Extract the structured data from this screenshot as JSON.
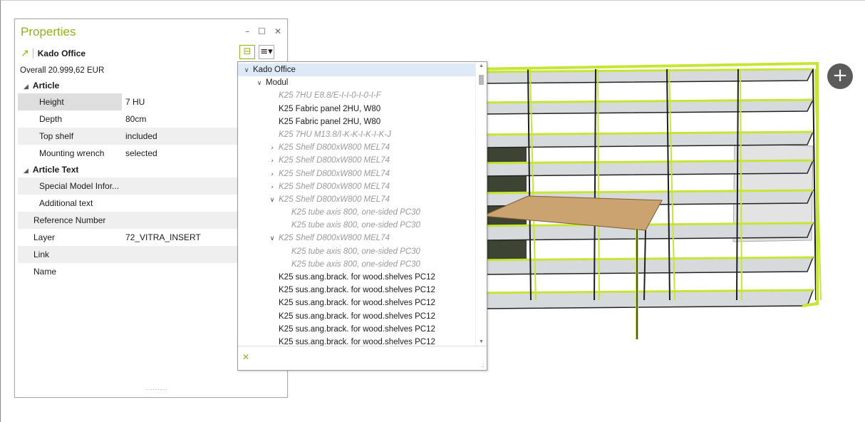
{
  "panel": {
    "title": "Properties",
    "controls": {
      "minimize": "–",
      "maximize": "☐",
      "close": "✕"
    },
    "object_name": "Kado Office",
    "overall": "Overall 20.999,62 EUR",
    "grip": "........."
  },
  "properties": [
    {
      "type": "section",
      "label": "Article"
    },
    {
      "type": "row",
      "label": "Height",
      "value": "7 HU",
      "selected": true
    },
    {
      "type": "row",
      "label": "Depth",
      "value": "80cm"
    },
    {
      "type": "row",
      "label": "Top shelf",
      "value": "included",
      "alt": true
    },
    {
      "type": "row",
      "label": "Mounting wrench",
      "value": "selected"
    },
    {
      "type": "section",
      "label": "Article Text"
    },
    {
      "type": "row",
      "label": "Special Model Infor...",
      "value": "",
      "alt": true
    },
    {
      "type": "row",
      "label": "Additional text",
      "value": ""
    },
    {
      "type": "row1",
      "label": "Reference Number",
      "value": "",
      "alt": true
    },
    {
      "type": "row1",
      "label": "Layer",
      "value": "72_VITRA_INSERT"
    },
    {
      "type": "row1",
      "label": "Link",
      "value": "",
      "alt": true
    },
    {
      "type": "row1",
      "label": "Name",
      "value": ""
    }
  ],
  "tree": {
    "items": [
      {
        "label": "Kado Office",
        "indent": 0,
        "chev": "v",
        "selected": true
      },
      {
        "label": "Modul",
        "indent": 1,
        "chev": "v"
      },
      {
        "label": "K25 7HU E8.8/E-I-I-0-I-0-I-F",
        "indent": 2,
        "dim": true
      },
      {
        "label": "K25 Fabric panel 2HU, W80",
        "indent": 2
      },
      {
        "label": "K25 Fabric panel 2HU, W80",
        "indent": 2
      },
      {
        "label": "K25 7HU M13.8/I-K-K-I-K-I-K-J",
        "indent": 2,
        "dim": true
      },
      {
        "label": "K25 Shelf D800xW800 MEL74",
        "indent": 2,
        "dim": true,
        "chev": ">"
      },
      {
        "label": "K25 Shelf D800xW800 MEL74",
        "indent": 2,
        "dim": true,
        "chev": ">"
      },
      {
        "label": "K25 Shelf D800xW800 MEL74",
        "indent": 2,
        "dim": true,
        "chev": ">"
      },
      {
        "label": "K25 Shelf D800xW800 MEL74",
        "indent": 2,
        "dim": true,
        "chev": ">"
      },
      {
        "label": "K25 Shelf D800xW800 MEL74",
        "indent": 2,
        "dim": true,
        "chev": "v"
      },
      {
        "label": "K25 tube axis 800, one-sided PC30",
        "indent": 3,
        "dim": true
      },
      {
        "label": "K25 tube axis 800, one-sided PC30",
        "indent": 3,
        "dim": true
      },
      {
        "label": "K25 Shelf D800xW800 MEL74",
        "indent": 2,
        "dim": true,
        "chev": "v"
      },
      {
        "label": "K25 tube axis 800, one-sided PC30",
        "indent": 3,
        "dim": true
      },
      {
        "label": "K25 tube axis 800, one-sided PC30",
        "indent": 3,
        "dim": true
      },
      {
        "label": "K25 sus.ang.brack. for wood.shelves PC12",
        "indent": 2
      },
      {
        "label": "K25 sus.ang.brack. for wood.shelves PC12",
        "indent": 2
      },
      {
        "label": "K25 sus.ang.brack. for wood.shelves PC12",
        "indent": 2
      },
      {
        "label": "K25 sus.ang.brack. for wood.shelves PC12",
        "indent": 2
      },
      {
        "label": "K25 sus.ang.brack. for wood.shelves PC12",
        "indent": 2
      },
      {
        "label": "K25 sus.ang.brack. for wood.shelves PC12",
        "indent": 2
      }
    ],
    "clear_icon": "✕",
    "resize_icon": ".:"
  },
  "toolbar": {
    "tree_icon": "tree-view-icon",
    "menu_icon": "menu-list-icon",
    "tree_glyph": "⊟",
    "menu_glyph": "≡▾"
  },
  "viewport": {
    "add_label": "+"
  },
  "colors": {
    "accent": "#8fb21c",
    "highlight": "#c6e635",
    "selection": "#dde9f7"
  }
}
